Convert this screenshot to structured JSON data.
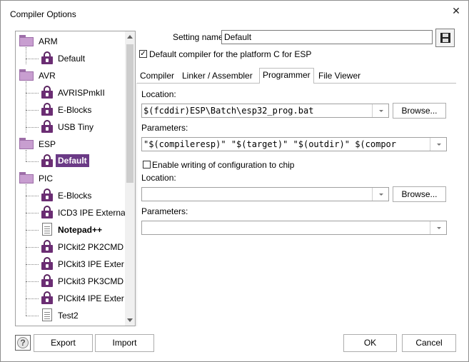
{
  "window": {
    "title": "Compiler Options",
    "close_label": "✕"
  },
  "tree": {
    "groups": [
      {
        "label": "ARM",
        "children": [
          {
            "label": "Default",
            "icon": "lock-icon"
          }
        ]
      },
      {
        "label": "AVR",
        "children": [
          {
            "label": "AVRISPmkII",
            "icon": "lock-icon"
          },
          {
            "label": "E-Blocks",
            "icon": "lock-icon"
          },
          {
            "label": "USB Tiny",
            "icon": "lock-icon"
          }
        ]
      },
      {
        "label": "ESP",
        "children": [
          {
            "label": "Default",
            "icon": "lock-icon",
            "selected": true
          }
        ]
      },
      {
        "label": "PIC",
        "children": [
          {
            "label": "E-Blocks",
            "icon": "lock-icon"
          },
          {
            "label": "ICD3 IPE Externa",
            "icon": "lock-icon"
          },
          {
            "label": "Notepad++",
            "icon": "document-icon",
            "bold": true
          },
          {
            "label": "PICkit2 PK2CMD I",
            "icon": "lock-icon"
          },
          {
            "label": "PICkit3 IPE Exter",
            "icon": "lock-icon"
          },
          {
            "label": "PICkit3 PK3CMD I",
            "icon": "lock-icon"
          },
          {
            "label": "PICkit4 IPE Exter",
            "icon": "lock-icon"
          },
          {
            "label": "Test2",
            "icon": "document-icon"
          }
        ]
      }
    ],
    "selected_color": "#6b3a86"
  },
  "setting": {
    "name_label": "Setting name:",
    "name_value": "Default",
    "default_checkbox_label": "Default compiler for the platform C for ESP",
    "default_checked": true
  },
  "tabs": [
    {
      "label": "Compiler"
    },
    {
      "label": "Linker / Assembler"
    },
    {
      "label": "Programmer",
      "active": true
    },
    {
      "label": "File Viewer"
    }
  ],
  "programmer": {
    "location_label": "Location:",
    "location_value": "$(fcddir)ESP\\Batch\\esp32_prog.bat",
    "browse_label": "Browse...",
    "parameters_label": "Parameters:",
    "parameters_value": "\"$(compileresp)\" \"$(target)\" \"$(outdir)\"  $(compor",
    "enable_config_label": "Enable writing of configuration to chip",
    "enable_config_checked": false,
    "config_location_label": "Location:",
    "config_location_value": "",
    "config_browse_label": "Browse...",
    "config_parameters_label": "Parameters:",
    "config_parameters_value": ""
  },
  "footer": {
    "help_icon": "question-icon",
    "export_label": "Export",
    "import_label": "Import",
    "ok_label": "OK",
    "cancel_label": "Cancel"
  }
}
